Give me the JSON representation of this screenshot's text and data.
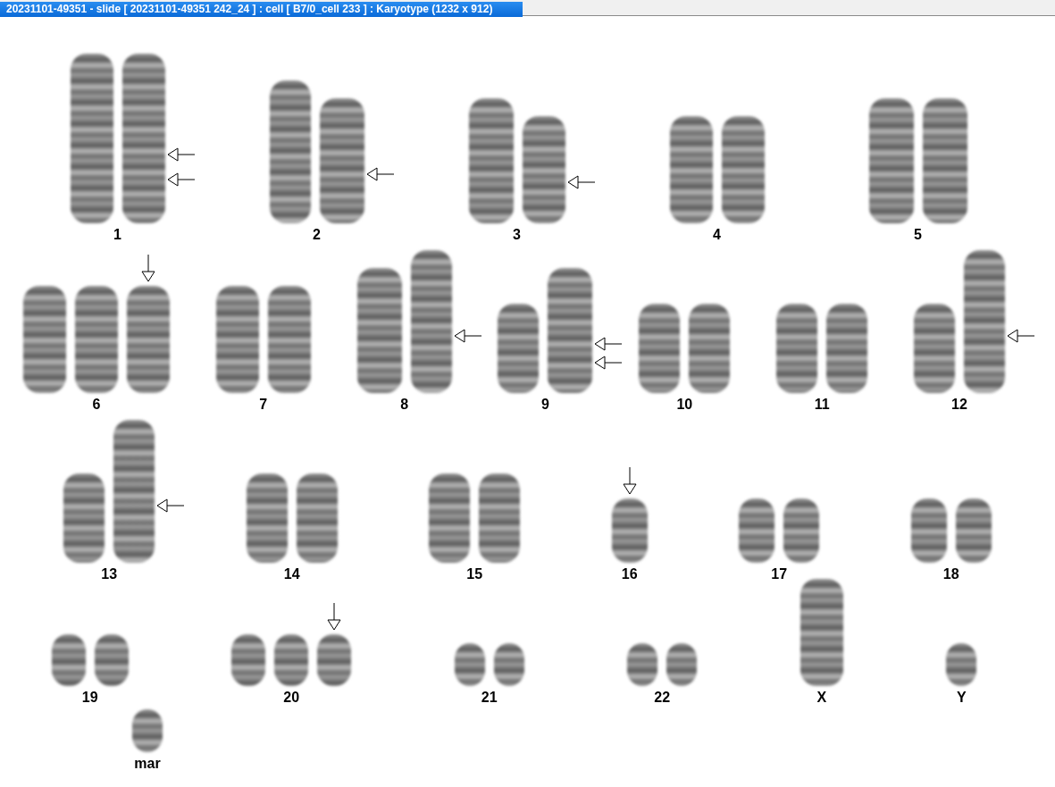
{
  "window": {
    "title": "20231101-49351 - slide [ 20231101-49351 242_24 ] : cell [ B7/0_cell 233 ] : Karyotype  (1232 x 912)"
  },
  "karyotype": {
    "rows": [
      {
        "groups": [
          {
            "label": "1",
            "chromosomes": [
              {
                "kind": "xl"
              },
              {
                "kind": "xl",
                "arrows": [
                  {
                    "kind": "left"
                  },
                  {
                    "kind": "left"
                  }
                ]
              }
            ]
          },
          {
            "label": "2",
            "chromosomes": [
              {
                "kind": "l"
              },
              {
                "kind": "m",
                "arrows": [
                  {
                    "kind": "left"
                  }
                ]
              }
            ]
          },
          {
            "label": "3",
            "chromosomes": [
              {
                "kind": "m"
              },
              {
                "kind": "ms",
                "arrows": [
                  {
                    "kind": "left"
                  }
                ]
              }
            ]
          },
          {
            "label": "4",
            "chromosomes": [
              {
                "kind": "ms"
              },
              {
                "kind": "ms"
              }
            ]
          },
          {
            "label": "5",
            "chromosomes": [
              {
                "kind": "m"
              },
              {
                "kind": "m"
              }
            ]
          }
        ]
      },
      {
        "groups": [
          {
            "label": "6",
            "chromosomes": [
              {
                "kind": "ms"
              },
              {
                "kind": "ms"
              },
              {
                "kind": "ms",
                "arrows": [
                  {
                    "kind": "down"
                  }
                ]
              }
            ]
          },
          {
            "label": "7",
            "chromosomes": [
              {
                "kind": "ms"
              },
              {
                "kind": "ms"
              }
            ]
          },
          {
            "label": "8",
            "chromosomes": [
              {
                "kind": "m"
              },
              {
                "kind": "l",
                "arrows": [
                  {
                    "kind": "left"
                  }
                ]
              }
            ]
          },
          {
            "label": "9",
            "chromosomes": [
              {
                "kind": "s"
              },
              {
                "kind": "m",
                "arrows": [
                  {
                    "kind": "left"
                  },
                  {
                    "kind": "left"
                  }
                ]
              }
            ]
          },
          {
            "label": "10",
            "chromosomes": [
              {
                "kind": "s"
              },
              {
                "kind": "s"
              }
            ]
          },
          {
            "label": "11",
            "chromosomes": [
              {
                "kind": "s"
              },
              {
                "kind": "s"
              }
            ]
          },
          {
            "label": "12",
            "chromosomes": [
              {
                "kind": "s"
              },
              {
                "kind": "l",
                "arrows": [
                  {
                    "kind": "left"
                  }
                ]
              }
            ]
          }
        ]
      },
      {
        "groups": [
          {
            "label": "13",
            "chromosomes": [
              {
                "kind": "s"
              },
              {
                "kind": "l",
                "arrows": [
                  {
                    "kind": "left"
                  }
                ]
              }
            ]
          },
          {
            "label": "14",
            "chromosomes": [
              {
                "kind": "s"
              },
              {
                "kind": "s"
              }
            ]
          },
          {
            "label": "15",
            "chromosomes": [
              {
                "kind": "s"
              },
              {
                "kind": "s"
              }
            ]
          },
          {
            "label": "16",
            "chromosomes": [
              {
                "kind": "xs",
                "arrows": [
                  {
                    "kind": "down"
                  }
                ]
              }
            ]
          },
          {
            "label": "17",
            "chromosomes": [
              {
                "kind": "xs"
              },
              {
                "kind": "xs"
              }
            ]
          },
          {
            "label": "18",
            "chromosomes": [
              {
                "kind": "xs"
              },
              {
                "kind": "xs"
              }
            ]
          }
        ]
      },
      {
        "groups": [
          {
            "label": "19",
            "chromosomes": [
              {
                "kind": "xxs"
              },
              {
                "kind": "xxs"
              }
            ]
          },
          {
            "label": "20",
            "chromosomes": [
              {
                "kind": "xxs"
              },
              {
                "kind": "xxs"
              },
              {
                "kind": "xxs",
                "arrows": [
                  {
                    "kind": "down"
                  }
                ]
              }
            ]
          },
          {
            "label": "21",
            "chromosomes": [
              {
                "kind": "tiny"
              },
              {
                "kind": "tiny"
              }
            ]
          },
          {
            "label": "22",
            "chromosomes": [
              {
                "kind": "tiny"
              },
              {
                "kind": "tiny"
              }
            ]
          },
          {
            "label": "X",
            "chromosomes": [
              {
                "kind": "ms"
              }
            ]
          },
          {
            "label": "Y",
            "chromosomes": [
              {
                "kind": "tiny"
              }
            ]
          }
        ]
      },
      {
        "groups": [
          {
            "label": "mar",
            "chromosomes": [
              {
                "kind": "tiny"
              }
            ]
          }
        ]
      }
    ]
  }
}
